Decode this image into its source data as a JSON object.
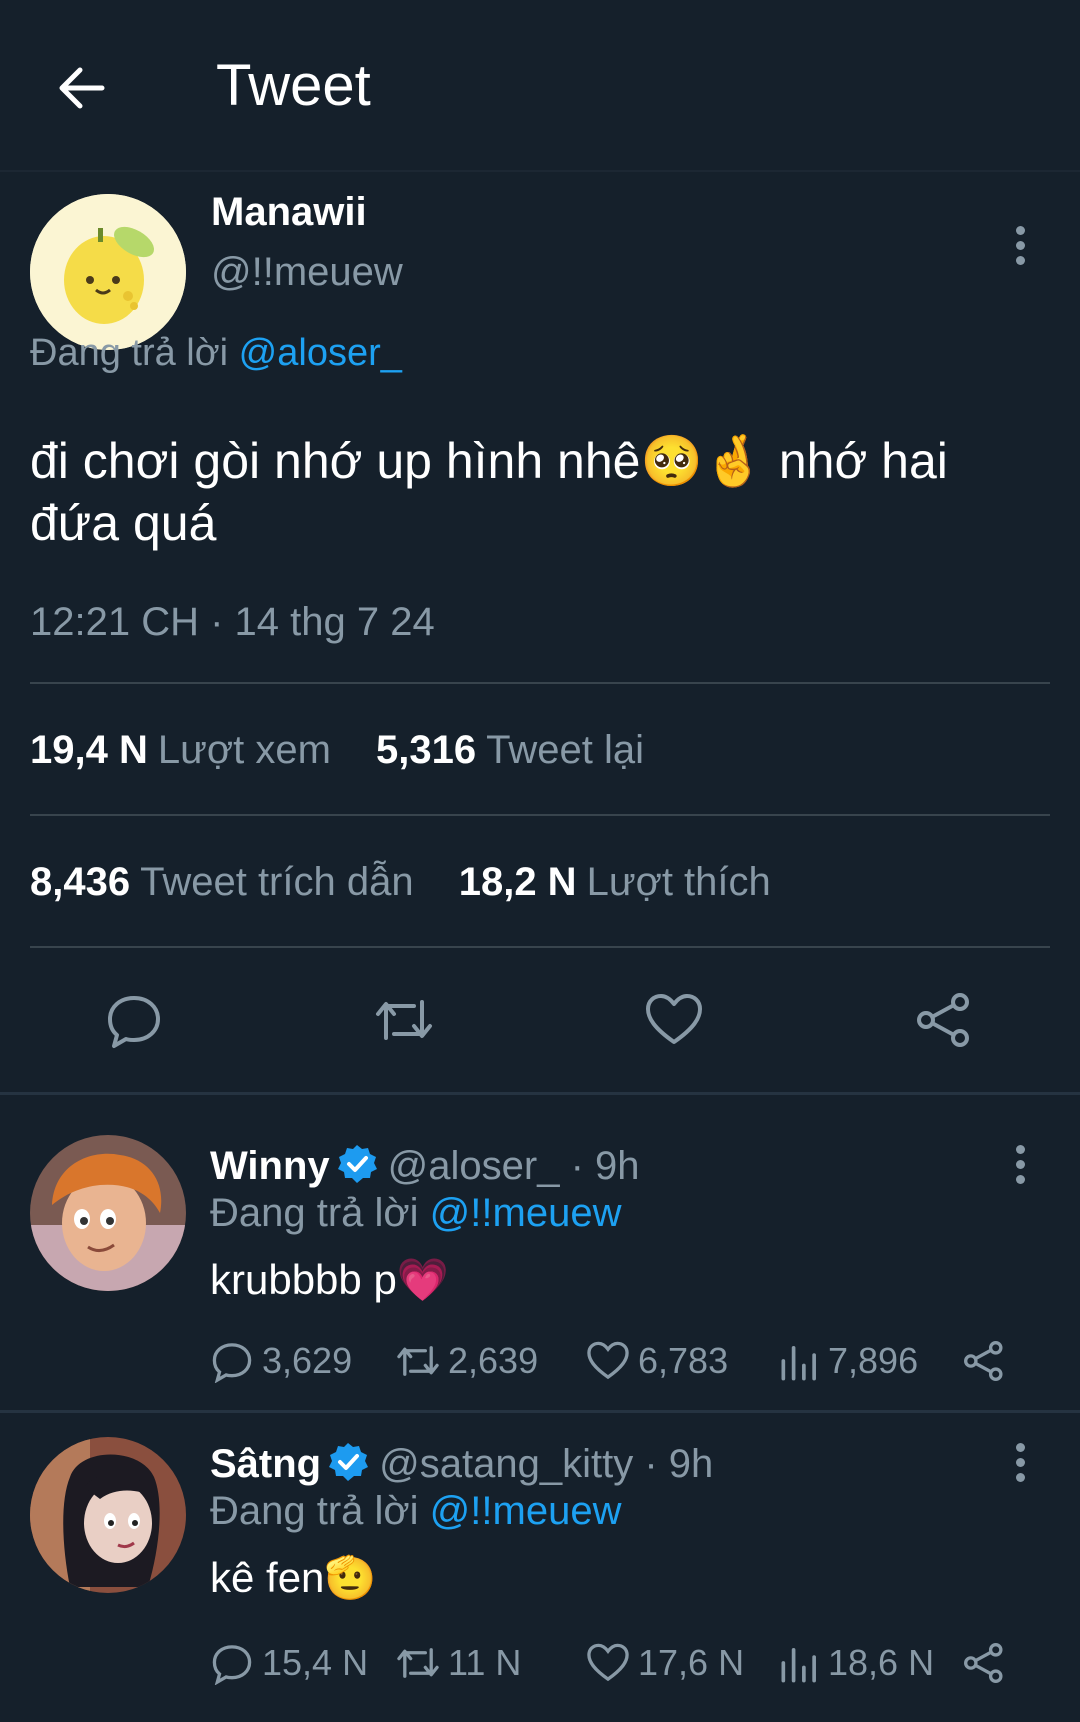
{
  "header": {
    "title": "Tweet"
  },
  "tweet": {
    "author_name": "Manawii",
    "author_handle": "@!!meuew",
    "reply_prefix": "Đang trả lời",
    "reply_to": "@aloser_",
    "text_part1": "đi chơi gòi nhớ up hình nhê",
    "text_emoji": "🥺🤞",
    "text_part2": " nhớ hai",
    "text_line2": "đứa quá",
    "timestamp": "12:21 CH · 14 thg 7 24",
    "stats": {
      "views_num": "19,4 N",
      "views_label": "Lượt xem",
      "retweets_num": "5,316",
      "retweets_label": "Tweet lại",
      "quotes_num": "8,436",
      "quotes_label": "Tweet trích dẫn",
      "likes_num": "18,2 N",
      "likes_label": "Lượt thích"
    }
  },
  "replies": [
    {
      "name": "Winny",
      "handle": "@aloser_",
      "time": "· 9h",
      "reply_prefix": "Đang trả lời",
      "reply_to": "@!!meuew",
      "text": "krubbbb p",
      "emoji": "💗",
      "replies": "3,629",
      "retweets": "2,639",
      "likes": "6,783",
      "views": "7,896"
    },
    {
      "name": "Sâtng",
      "handle": "@satang_kitty",
      "time": "· 9h",
      "reply_prefix": "Đang trả lời",
      "reply_to": "@!!meuew",
      "text": "kê fen",
      "emoji": "🫡",
      "replies": "15,4 N",
      "retweets": "11 N",
      "likes": "17,6 N",
      "views": "18,6 N"
    }
  ],
  "colors": {
    "background": "#15202b",
    "accent": "#1da1f2",
    "muted": "#8899a6",
    "divider": "#38444d"
  },
  "icons": [
    "back-arrow-icon",
    "more-vertical-icon",
    "reply-icon",
    "retweet-icon",
    "like-icon",
    "share-icon",
    "views-icon",
    "verified-icon"
  ]
}
